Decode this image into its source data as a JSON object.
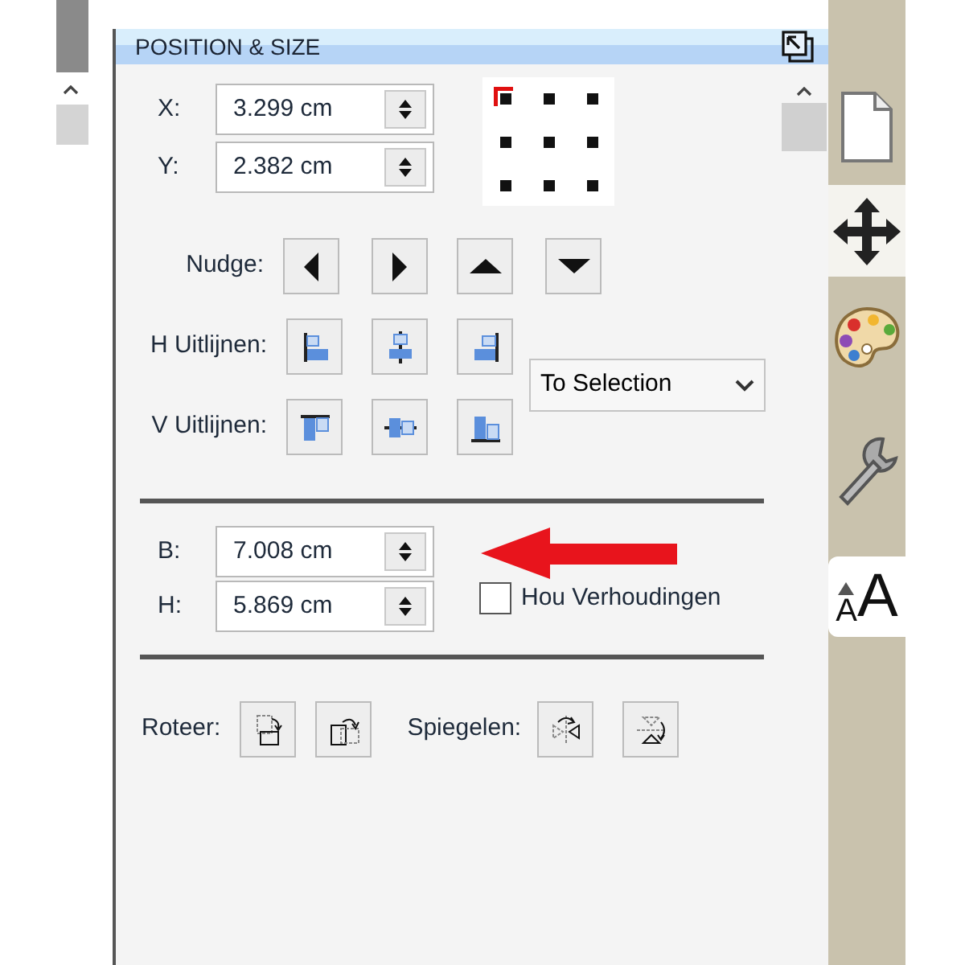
{
  "panel": {
    "title": "POSITION & SIZE"
  },
  "position_fields": [
    {
      "label": "X:",
      "value": "3.299 cm"
    },
    {
      "label": "Y:",
      "value": "2.382 cm"
    }
  ],
  "anchor_points": [
    {
      "selected": true
    },
    {
      "selected": false
    },
    {
      "selected": false
    },
    {
      "selected": false
    },
    {
      "selected": false
    },
    {
      "selected": false
    },
    {
      "selected": false
    },
    {
      "selected": false
    },
    {
      "selected": false
    }
  ],
  "nudge": {
    "label": "Nudge:",
    "buttons": [
      {
        "kind": "left"
      },
      {
        "kind": "right"
      },
      {
        "kind": "up"
      },
      {
        "kind": "down"
      }
    ]
  },
  "h_align": {
    "label": "H Uitlijnen:",
    "buttons": [
      {
        "kind": "left"
      },
      {
        "kind": "center"
      },
      {
        "kind": "right"
      }
    ]
  },
  "v_align": {
    "label": "V Uitlijnen:",
    "buttons": [
      {
        "kind": "top"
      },
      {
        "kind": "middle"
      },
      {
        "kind": "bottom"
      }
    ]
  },
  "align_to": {
    "value": "To Selection"
  },
  "size_fields": [
    {
      "label": "B:",
      "value": "7.008 cm"
    },
    {
      "label": "H:",
      "value": "5.869 cm"
    }
  ],
  "keep_ratio": {
    "label": "Hou Verhoudingen",
    "checked": false
  },
  "rotate": {
    "label": "Roteer:"
  },
  "mirror": {
    "label": "Spiegelen:"
  },
  "side_tabs": [
    {
      "kind": "page",
      "highlighted": false
    },
    {
      "kind": "move",
      "highlighted": true
    },
    {
      "kind": "palette",
      "highlighted": false
    },
    {
      "kind": "wrench",
      "highlighted": false
    },
    {
      "kind": "text",
      "highlighted": true,
      "small_letter": "A",
      "large_letter": "A"
    }
  ]
}
